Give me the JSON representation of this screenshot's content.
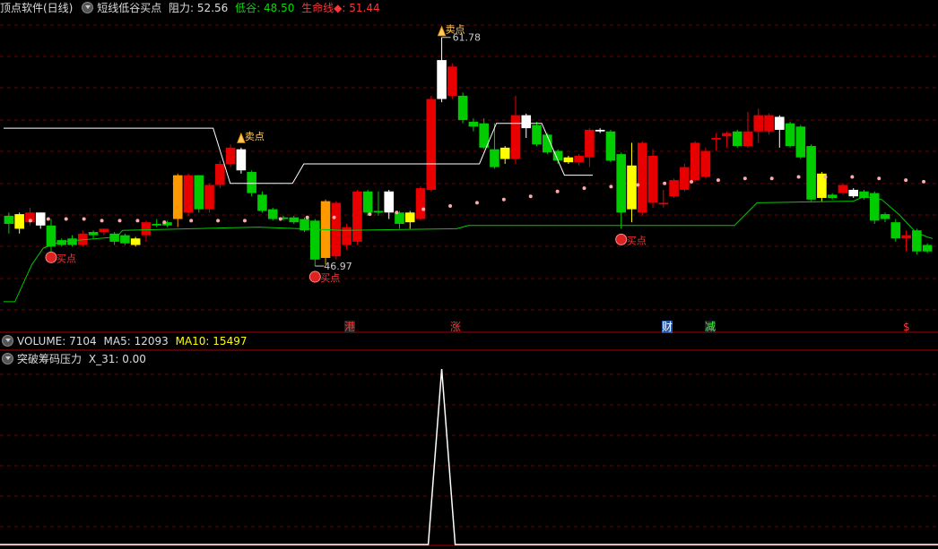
{
  "header": {
    "app_title": "顶点软件(日线)",
    "indicator_name": "短线低谷买点",
    "resistance_label": "阻力:",
    "resistance_value": "52.56",
    "valley_label": "低谷:",
    "valley_value": "48.50",
    "lifeline_label": "生命线◆:",
    "lifeline_value": "51.44"
  },
  "volume_header": {
    "volume_label": "VOLUME:",
    "volume_value": "7104",
    "ma5_label": "MA5:",
    "ma5_value": "12093",
    "ma10_label": "MA10:",
    "ma10_value": "15497"
  },
  "indicator_header": {
    "name": "突破筹码压力",
    "x31_label": "X_31:",
    "x31_value": "0.00"
  },
  "colors": {
    "up": "#e80000",
    "down": "#00cc00",
    "white_candle": "#ffffff",
    "yellow": "#ffff00",
    "orange": "#ff9900",
    "dots": "#ffaaaa",
    "grid": "#6a0000",
    "resistance_line": "#ffffff",
    "support_line": "#00cc00"
  },
  "chart_data": {
    "type": "candlestick",
    "ylim": [
      44.5,
      63.0
    ],
    "annotations": {
      "high_label": "61.78",
      "low_label": "46.97",
      "buy_label_1": "买点",
      "buy_label_2": "买点",
      "buy_label_3": "买点",
      "sell_label_1": "卖点",
      "sell_label_2": "卖点"
    },
    "candles": [
      {
        "o": 50.3,
        "c": 50.8,
        "h": 51.0,
        "l": 49.7,
        "col": "green"
      },
      {
        "o": 50.9,
        "c": 50.0,
        "h": 51.0,
        "l": 49.7,
        "col": "yellow"
      },
      {
        "o": 51.0,
        "c": 50.4,
        "h": 51.3,
        "l": 50.2,
        "col": "red"
      },
      {
        "o": 51.0,
        "c": 50.2,
        "h": 51.0,
        "l": 50.0,
        "col": "white"
      },
      {
        "o": 50.2,
        "c": 48.9,
        "h": 50.6,
        "l": 48.6,
        "col": "green"
      },
      {
        "o": 49.3,
        "c": 49.0,
        "h": 49.4,
        "l": 48.9,
        "col": "green"
      },
      {
        "o": 49.4,
        "c": 49.0,
        "h": 49.6,
        "l": 48.9,
        "col": "green"
      },
      {
        "o": 49.0,
        "c": 49.7,
        "h": 49.9,
        "l": 48.9,
        "col": "red"
      },
      {
        "o": 49.8,
        "c": 49.6,
        "h": 49.9,
        "l": 49.4,
        "col": "green"
      },
      {
        "o": 49.8,
        "c": 50.0,
        "h": 50.0,
        "l": 49.6,
        "col": "red"
      },
      {
        "o": 49.7,
        "c": 49.2,
        "h": 49.8,
        "l": 49.0,
        "col": "green"
      },
      {
        "o": 49.6,
        "c": 49.1,
        "h": 49.7,
        "l": 49.0,
        "col": "green"
      },
      {
        "o": 49.4,
        "c": 49.0,
        "h": 49.5,
        "l": 48.9,
        "col": "yellow"
      },
      {
        "o": 49.6,
        "c": 50.4,
        "h": 50.5,
        "l": 49.2,
        "col": "red"
      },
      {
        "o": 50.2,
        "c": 50.3,
        "h": 50.6,
        "l": 50.1,
        "col": "green"
      },
      {
        "o": 50.2,
        "c": 50.4,
        "h": 50.5,
        "l": 50.1,
        "col": "green"
      },
      {
        "o": 50.6,
        "c": 53.3,
        "h": 53.4,
        "l": 50.1,
        "col": "orange"
      },
      {
        "o": 51.0,
        "c": 53.3,
        "h": 53.4,
        "l": 50.8,
        "col": "red"
      },
      {
        "o": 53.3,
        "c": 51.2,
        "h": 53.3,
        "l": 51.0,
        "col": "green"
      },
      {
        "o": 51.2,
        "c": 52.7,
        "h": 52.8,
        "l": 51.0,
        "col": "red"
      },
      {
        "o": 52.7,
        "c": 54.0,
        "h": 54.2,
        "l": 52.5,
        "col": "red"
      },
      {
        "o": 54.0,
        "c": 55.0,
        "h": 55.2,
        "l": 53.8,
        "col": "red"
      },
      {
        "o": 54.9,
        "c": 53.6,
        "h": 55.0,
        "l": 53.4,
        "col": "white"
      },
      {
        "o": 53.5,
        "c": 52.2,
        "h": 53.6,
        "l": 52.0,
        "col": "green"
      },
      {
        "o": 52.1,
        "c": 51.1,
        "h": 52.3,
        "l": 51.0,
        "col": "green"
      },
      {
        "o": 51.2,
        "c": 50.6,
        "h": 51.3,
        "l": 50.5,
        "col": "green"
      },
      {
        "o": 50.7,
        "c": 50.6,
        "h": 50.8,
        "l": 50.5,
        "col": "green"
      },
      {
        "o": 50.7,
        "c": 50.4,
        "h": 50.8,
        "l": 50.3,
        "col": "green"
      },
      {
        "o": 50.6,
        "c": 49.9,
        "h": 50.7,
        "l": 49.8,
        "col": "green"
      },
      {
        "o": 50.5,
        "c": 48.1,
        "h": 50.6,
        "l": 47.7,
        "col": "green"
      },
      {
        "o": 48.2,
        "c": 51.7,
        "h": 51.8,
        "l": 47.8,
        "col": "orange"
      },
      {
        "o": 48.3,
        "c": 51.6,
        "h": 51.7,
        "l": 48.1,
        "col": "red"
      },
      {
        "o": 49.0,
        "c": 50.1,
        "h": 50.3,
        "l": 48.7,
        "col": "red"
      },
      {
        "o": 49.2,
        "c": 52.3,
        "h": 52.4,
        "l": 49.0,
        "col": "red"
      },
      {
        "o": 52.3,
        "c": 51.0,
        "h": 52.4,
        "l": 50.8,
        "col": "green"
      },
      {
        "o": 51.1,
        "c": 51.0,
        "h": 52.3,
        "l": 50.8,
        "col": "green"
      },
      {
        "o": 51.0,
        "c": 52.3,
        "h": 52.4,
        "l": 50.6,
        "col": "white"
      },
      {
        "o": 51.0,
        "c": 50.3,
        "h": 51.1,
        "l": 50.0,
        "col": "green"
      },
      {
        "o": 50.4,
        "c": 51.0,
        "h": 51.1,
        "l": 50.0,
        "col": "yellow"
      },
      {
        "o": 50.6,
        "c": 52.5,
        "h": 52.6,
        "l": 50.5,
        "col": "red"
      },
      {
        "o": 52.4,
        "c": 58.0,
        "h": 58.2,
        "l": 52.3,
        "col": "red"
      },
      {
        "o": 58.0,
        "c": 60.4,
        "h": 61.8,
        "l": 57.8,
        "col": "white"
      },
      {
        "o": 58.2,
        "c": 60.0,
        "h": 60.2,
        "l": 58.0,
        "col": "red"
      },
      {
        "o": 58.2,
        "c": 56.7,
        "h": 58.4,
        "l": 56.5,
        "col": "green"
      },
      {
        "o": 56.6,
        "c": 56.3,
        "h": 56.8,
        "l": 56.0,
        "col": "green"
      },
      {
        "o": 56.5,
        "c": 55.0,
        "h": 56.8,
        "l": 54.9,
        "col": "green"
      },
      {
        "o": 54.9,
        "c": 53.8,
        "h": 56.5,
        "l": 53.7,
        "col": "green"
      },
      {
        "o": 55.0,
        "c": 54.3,
        "h": 55.1,
        "l": 54.0,
        "col": "yellow"
      },
      {
        "o": 54.3,
        "c": 57.0,
        "h": 58.2,
        "l": 54.0,
        "col": "red"
      },
      {
        "o": 56.2,
        "c": 57.0,
        "h": 57.1,
        "l": 55.6,
        "col": "white"
      },
      {
        "o": 56.4,
        "c": 55.2,
        "h": 56.6,
        "l": 55.1,
        "col": "green"
      },
      {
        "o": 55.8,
        "c": 54.7,
        "h": 55.9,
        "l": 54.6,
        "col": "green"
      },
      {
        "o": 54.8,
        "c": 54.2,
        "h": 54.9,
        "l": 54.0,
        "col": "green"
      },
      {
        "o": 54.4,
        "c": 54.1,
        "h": 54.5,
        "l": 54.0,
        "col": "yellow"
      },
      {
        "o": 54.1,
        "c": 54.5,
        "h": 54.6,
        "l": 53.9,
        "col": "red"
      },
      {
        "o": 54.4,
        "c": 56.1,
        "h": 56.2,
        "l": 53.8,
        "col": "red"
      },
      {
        "o": 56.1,
        "c": 56.0,
        "h": 56.2,
        "l": 55.9,
        "col": "white"
      },
      {
        "o": 56.0,
        "c": 54.2,
        "h": 56.1,
        "l": 54.1,
        "col": "green"
      },
      {
        "o": 54.6,
        "c": 51.0,
        "h": 54.7,
        "l": 50.0,
        "col": "green"
      },
      {
        "o": 51.2,
        "c": 53.9,
        "h": 55.3,
        "l": 50.4,
        "col": "yellow"
      },
      {
        "o": 51.0,
        "c": 55.3,
        "h": 55.4,
        "l": 50.8,
        "col": "red"
      },
      {
        "o": 51.6,
        "c": 54.5,
        "h": 54.9,
        "l": 51.3,
        "col": "red"
      },
      {
        "o": 51.6,
        "c": 51.5,
        "h": 52.4,
        "l": 51.3,
        "col": "red"
      },
      {
        "o": 52.0,
        "c": 53.0,
        "h": 53.1,
        "l": 51.9,
        "col": "red"
      },
      {
        "o": 52.4,
        "c": 53.8,
        "h": 54.0,
        "l": 52.3,
        "col": "red"
      },
      {
        "o": 53.0,
        "c": 55.3,
        "h": 55.4,
        "l": 52.9,
        "col": "red"
      },
      {
        "o": 53.2,
        "c": 54.8,
        "h": 55.0,
        "l": 53.1,
        "col": "red"
      },
      {
        "o": 55.5,
        "c": 55.6,
        "h": 55.9,
        "l": 54.8,
        "col": "red"
      },
      {
        "o": 55.9,
        "c": 55.7,
        "h": 56.0,
        "l": 55.0,
        "col": "red"
      },
      {
        "o": 56.0,
        "c": 55.1,
        "h": 56.1,
        "l": 55.0,
        "col": "green"
      },
      {
        "o": 55.1,
        "c": 56.0,
        "h": 57.2,
        "l": 55.0,
        "col": "red"
      },
      {
        "o": 56.0,
        "c": 57.0,
        "h": 57.4,
        "l": 55.3,
        "col": "red"
      },
      {
        "o": 56.0,
        "c": 57.0,
        "h": 57.1,
        "l": 55.8,
        "col": "red"
      },
      {
        "o": 56.9,
        "c": 56.1,
        "h": 57.0,
        "l": 55.0,
        "col": "white"
      },
      {
        "o": 56.5,
        "c": 55.1,
        "h": 56.6,
        "l": 55.0,
        "col": "green"
      },
      {
        "o": 56.3,
        "c": 54.4,
        "h": 56.4,
        "l": 54.3,
        "col": "green"
      },
      {
        "o": 55.1,
        "c": 51.8,
        "h": 55.2,
        "l": 51.7,
        "col": "green"
      },
      {
        "o": 53.4,
        "c": 51.9,
        "h": 53.5,
        "l": 51.7,
        "col": "yellow"
      },
      {
        "o": 51.9,
        "c": 52.1,
        "h": 52.2,
        "l": 51.8,
        "col": "green"
      },
      {
        "o": 52.2,
        "c": 52.7,
        "h": 52.8,
        "l": 52.1,
        "col": "red"
      },
      {
        "o": 52.4,
        "c": 52.0,
        "h": 52.5,
        "l": 51.9,
        "col": "white"
      },
      {
        "o": 52.3,
        "c": 51.9,
        "h": 52.4,
        "l": 51.8,
        "col": "green"
      },
      {
        "o": 52.2,
        "c": 50.5,
        "h": 52.3,
        "l": 50.3,
        "col": "green"
      },
      {
        "o": 50.9,
        "c": 50.6,
        "h": 51.0,
        "l": 50.4,
        "col": "green"
      },
      {
        "o": 50.4,
        "c": 49.4,
        "h": 50.6,
        "l": 49.2,
        "col": "green"
      },
      {
        "o": 49.4,
        "c": 49.6,
        "h": 49.9,
        "l": 48.6,
        "col": "red"
      },
      {
        "o": 49.9,
        "c": 48.6,
        "h": 50.0,
        "l": 48.4,
        "col": "green"
      },
      {
        "o": 49.0,
        "c": 48.6,
        "h": 49.1,
        "l": 48.5,
        "col": "green"
      }
    ],
    "resistance_line": [
      [
        0,
        56.2
      ],
      [
        37,
        56.2
      ],
      [
        40,
        52.8
      ],
      [
        51,
        52.8
      ],
      [
        53,
        54.0
      ],
      [
        84,
        54.0
      ],
      [
        87,
        56.5
      ],
      [
        95,
        56.5
      ],
      [
        99,
        53.3
      ],
      [
        104,
        53.3
      ]
    ],
    "support_line": [
      [
        0,
        45.5
      ],
      [
        2,
        45.5
      ],
      [
        5,
        47.8
      ],
      [
        7,
        48.8
      ],
      [
        10,
        49.2
      ],
      [
        20,
        49.5
      ],
      [
        21,
        49.9
      ],
      [
        45,
        50.1
      ],
      [
        60,
        49.9
      ],
      [
        80,
        50.0
      ],
      [
        82,
        50.2
      ],
      [
        129,
        50.2
      ],
      [
        133,
        51.6
      ],
      [
        150,
        51.7
      ],
      [
        152,
        52.0
      ],
      [
        155,
        51.8
      ],
      [
        158,
        50.9
      ],
      [
        161,
        49.8
      ],
      [
        163,
        49.5
      ],
      [
        164,
        49.4
      ]
    ],
    "dots": [
      [
        3,
        50.5
      ],
      [
        5,
        50.6
      ],
      [
        7,
        50.6
      ],
      [
        9,
        50.6
      ],
      [
        11,
        50.5
      ],
      [
        13,
        50.5
      ],
      [
        15,
        50.5
      ],
      [
        18,
        50.4
      ],
      [
        21,
        50.5
      ],
      [
        24,
        50.5
      ],
      [
        27,
        50.5
      ],
      [
        31,
        50.6
      ],
      [
        34,
        50.7
      ],
      [
        37,
        50.7
      ],
      [
        41,
        50.9
      ],
      [
        44,
        51.0
      ],
      [
        47,
        51.2
      ],
      [
        50,
        51.4
      ],
      [
        53,
        51.6
      ],
      [
        56,
        51.8
      ],
      [
        59,
        52.0
      ],
      [
        62,
        52.3
      ],
      [
        65,
        52.5
      ],
      [
        68,
        52.6
      ],
      [
        71,
        52.7
      ],
      [
        74,
        52.8
      ],
      [
        77,
        52.9
      ],
      [
        80,
        53.0
      ],
      [
        83,
        53.1
      ],
      [
        86,
        53.1
      ],
      [
        89,
        53.2
      ],
      [
        92,
        53.2
      ],
      [
        95,
        53.2
      ],
      [
        98,
        53.1
      ],
      [
        101,
        53.0
      ],
      [
        103,
        52.9
      ]
    ],
    "events": [
      "港",
      "涨",
      "财",
      "减",
      "$"
    ],
    "indicator": {
      "name": "X_31",
      "peak_value": 1,
      "base_value": 0
    }
  }
}
